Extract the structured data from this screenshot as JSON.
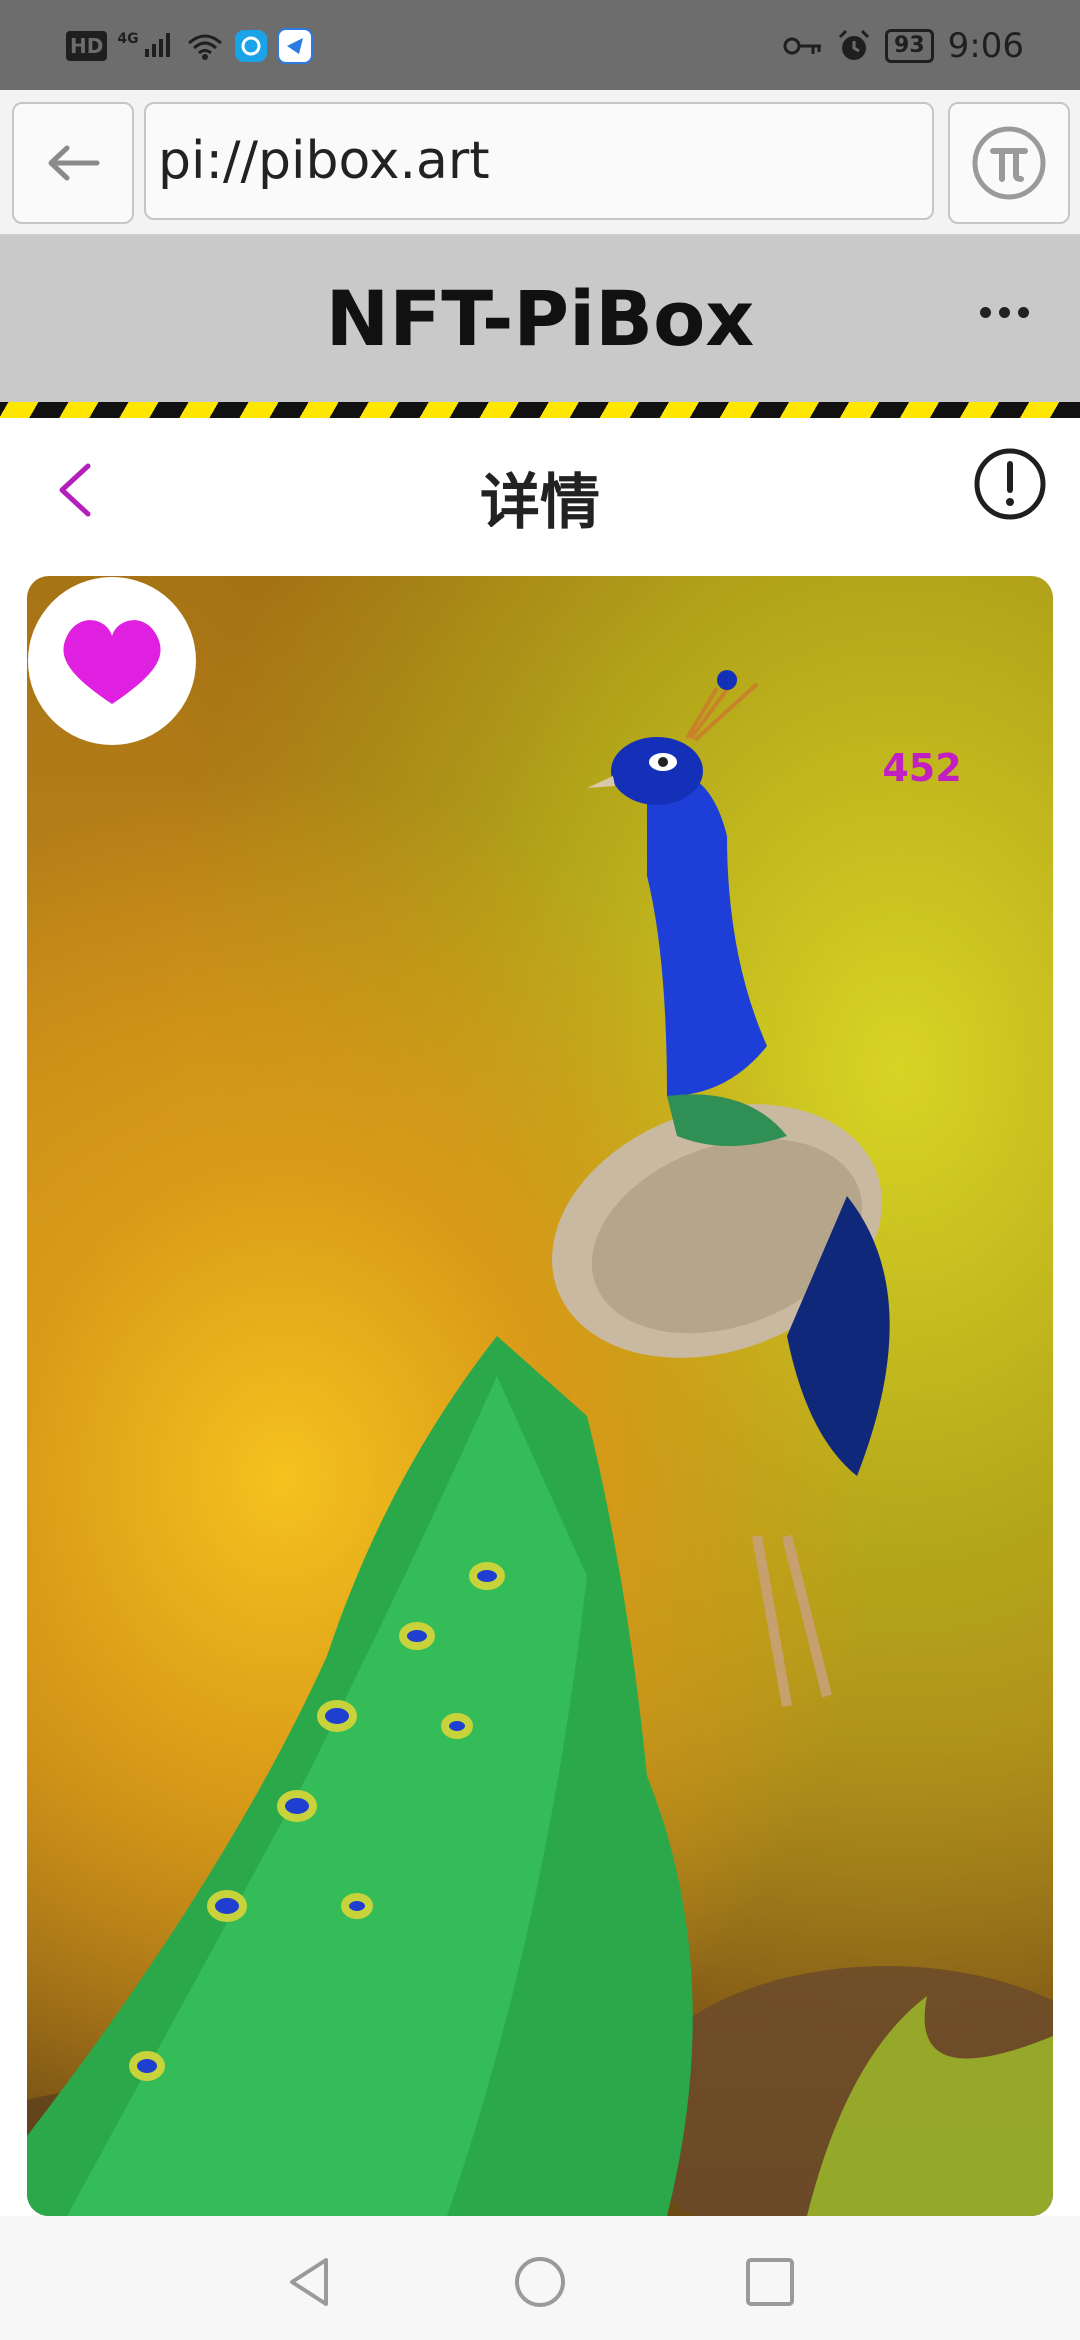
{
  "status_bar": {
    "network_label": "HD",
    "signal_label": "4G",
    "battery": "93",
    "time": "9:06"
  },
  "browser": {
    "url": "pi://pibox.art"
  },
  "app_header": {
    "title": "NFT-PiBox"
  },
  "detail": {
    "title": "详情",
    "likes": "452"
  },
  "colors": {
    "accent": "#b21fbd",
    "like_heart": "#e020e0",
    "hazard_yellow": "#ffe600",
    "header_bg": "#c9c9c9"
  },
  "icons": {
    "back": "arrow-left-icon",
    "pi": "pi-network-icon",
    "more": "more-horizontal-icon",
    "detail_back": "chevron-left-icon",
    "info": "info-circle-icon",
    "like": "heart-icon",
    "nav_back": "triangle-back-icon",
    "nav_home": "circle-home-icon",
    "nav_recent": "square-recent-icon"
  },
  "image": {
    "subject": "peacock"
  }
}
